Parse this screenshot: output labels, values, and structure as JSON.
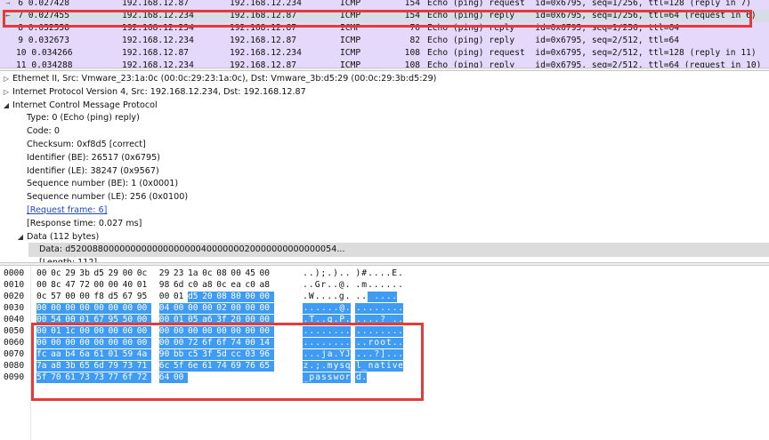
{
  "colors": {
    "row_bg": "#e4d9fb",
    "selected_bg": "#d6dde6",
    "highlight": "#3f9bf4",
    "annotation": "#e53a3a"
  },
  "packets": [
    {
      "no": "6",
      "time": "0.027428",
      "src": "192.168.12.87",
      "dst": "192.168.12.234",
      "proto": "ICMP",
      "len": "154",
      "info": "Echo (ping) request  id=0x6795, seq=1/256, ttl=128 (reply in 7)"
    },
    {
      "no": "7",
      "time": "0.027455",
      "src": "192.168.12.234",
      "dst": "192.168.12.87",
      "proto": "ICMP",
      "len": "154",
      "info": "Echo (ping) reply    id=0x6795, seq=1/256, ttl=64 (request in 6)"
    },
    {
      "no": "8",
      "time": "0.032558",
      "src": "192.168.12.234",
      "dst": "192.168.12.87",
      "proto": "ICMP",
      "len": "70",
      "info": "Echo (ping) reply    id=0x6795, seq=1/256, ttl=64"
    },
    {
      "no": "9",
      "time": "0.032673",
      "src": "192.168.12.234",
      "dst": "192.168.12.87",
      "proto": "ICMP",
      "len": "82",
      "info": "Echo (ping) reply    id=0x6795, seq=2/512, ttl=64"
    },
    {
      "no": "10",
      "time": "0.034266",
      "src": "192.168.12.87",
      "dst": "192.168.12.234",
      "proto": "ICMP",
      "len": "108",
      "info": "Echo (ping) request  id=0x6795, seq=2/512, ttl=128 (reply in 11)"
    },
    {
      "no": "11",
      "time": "0.034288",
      "src": "192.168.12.234",
      "dst": "192.168.12.87",
      "proto": "ICMP",
      "len": "108",
      "info": "Echo (ping) reply    id=0x6795, seq=2/512, ttl=64 (request in 10)"
    }
  ],
  "details": [
    {
      "text": "Ethernet II, Src: Vmware_23:1a:0c (00:0c:29:23:1a:0c), Dst: Vmware_3b:d5:29 (00:0c:29:3b:d5:29)",
      "indent": 0,
      "expander": "▷"
    },
    {
      "text": "Internet Protocol Version 4, Src: 192.168.12.234, Dst: 192.168.12.87",
      "indent": 0,
      "expander": "▷"
    },
    {
      "text": "Internet Control Message Protocol",
      "indent": 0,
      "expander": "◢"
    },
    {
      "text": "Type: 0 (Echo (ping) reply)",
      "indent": 1
    },
    {
      "text": "Code: 0",
      "indent": 1
    },
    {
      "text": "Checksum: 0xf8d5 [correct]",
      "indent": 1
    },
    {
      "text": "Identifier (BE): 26517 (0x6795)",
      "indent": 1
    },
    {
      "text": "Identifier (LE): 38247 (0x9567)",
      "indent": 1
    },
    {
      "text": "Sequence number (BE): 1 (0x0001)",
      "indent": 1
    },
    {
      "text": "Sequence number (LE): 256 (0x0100)",
      "indent": 1
    },
    {
      "text": "[Request frame: 6]",
      "indent": 1,
      "link": true
    },
    {
      "text": "[Response time: 0.027 ms]",
      "indent": 1
    },
    {
      "text": "Data (112 bytes)",
      "indent": 1,
      "expander": "◢"
    },
    {
      "text": "Data: d5200880000000000000000004000000020000000000000054...",
      "indent": 2
    },
    {
      "text": "[Length: 112]",
      "indent": 2
    }
  ],
  "bytes": [
    {
      "offset": "0000",
      "hex": [
        "00",
        "0c",
        "29",
        "3b",
        "d5",
        "29",
        "00",
        "0c",
        "29",
        "23",
        "1a",
        "0c",
        "08",
        "00",
        "45",
        "00"
      ],
      "ascii": "..);.).. )#....E."
    },
    {
      "offset": "0010",
      "hex": [
        "00",
        "8c",
        "47",
        "72",
        "00",
        "00",
        "40",
        "01",
        "98",
        "6d",
        "c0",
        "a8",
        "0c",
        "ea",
        "c0",
        "a8"
      ],
      "ascii": "..Gr..@. .m......"
    },
    {
      "offset": "0020",
      "hex": [
        "0c",
        "57",
        "00",
        "00",
        "f8",
        "d5",
        "67",
        "95",
        "00",
        "01",
        "d5",
        "20",
        "08",
        "80",
        "00",
        "00"
      ],
      "ascii": ".W....g. .. ...."
    },
    {
      "offset": "0030",
      "hex": [
        "00",
        "00",
        "00",
        "00",
        "00",
        "00",
        "00",
        "00",
        "04",
        "00",
        "00",
        "00",
        "02",
        "00",
        "00",
        "00"
      ],
      "ascii": "......@. ........"
    },
    {
      "offset": "0040",
      "hex": [
        "00",
        "54",
        "00",
        "01",
        "67",
        "95",
        "50",
        "00",
        "00",
        "01",
        "05",
        "a6",
        "3f",
        "20",
        "00",
        "00"
      ],
      "ascii": ".T..g.P. ....? .."
    },
    {
      "offset": "0050",
      "hex": [
        "00",
        "01",
        "1c",
        "00",
        "00",
        "00",
        "00",
        "00",
        "00",
        "00",
        "00",
        "00",
        "00",
        "00",
        "00",
        "00"
      ],
      "ascii": "........ ........"
    },
    {
      "offset": "0060",
      "hex": [
        "00",
        "00",
        "00",
        "00",
        "00",
        "00",
        "00",
        "00",
        "00",
        "00",
        "72",
        "6f",
        "6f",
        "74",
        "00",
        "14"
      ],
      "ascii": "........ ..root.."
    },
    {
      "offset": "0070",
      "hex": [
        "fc",
        "aa",
        "b4",
        "6a",
        "61",
        "01",
        "59",
        "4a",
        "90",
        "bb",
        "c5",
        "3f",
        "5d",
        "cc",
        "03",
        "96"
      ],
      "ascii": "...ja.YJ ...?]..."
    },
    {
      "offset": "0080",
      "hex": [
        "7a",
        "a8",
        "3b",
        "65",
        "6d",
        "79",
        "73",
        "71",
        "6c",
        "5f",
        "6e",
        "61",
        "74",
        "69",
        "76",
        "65"
      ],
      "ascii": "z.;.mysq l_native"
    },
    {
      "offset": "0090",
      "hex": [
        "5f",
        "70",
        "61",
        "73",
        "73",
        "77",
        "6f",
        "72",
        "64",
        "00"
      ],
      "ascii": "_passwor d."
    }
  ]
}
